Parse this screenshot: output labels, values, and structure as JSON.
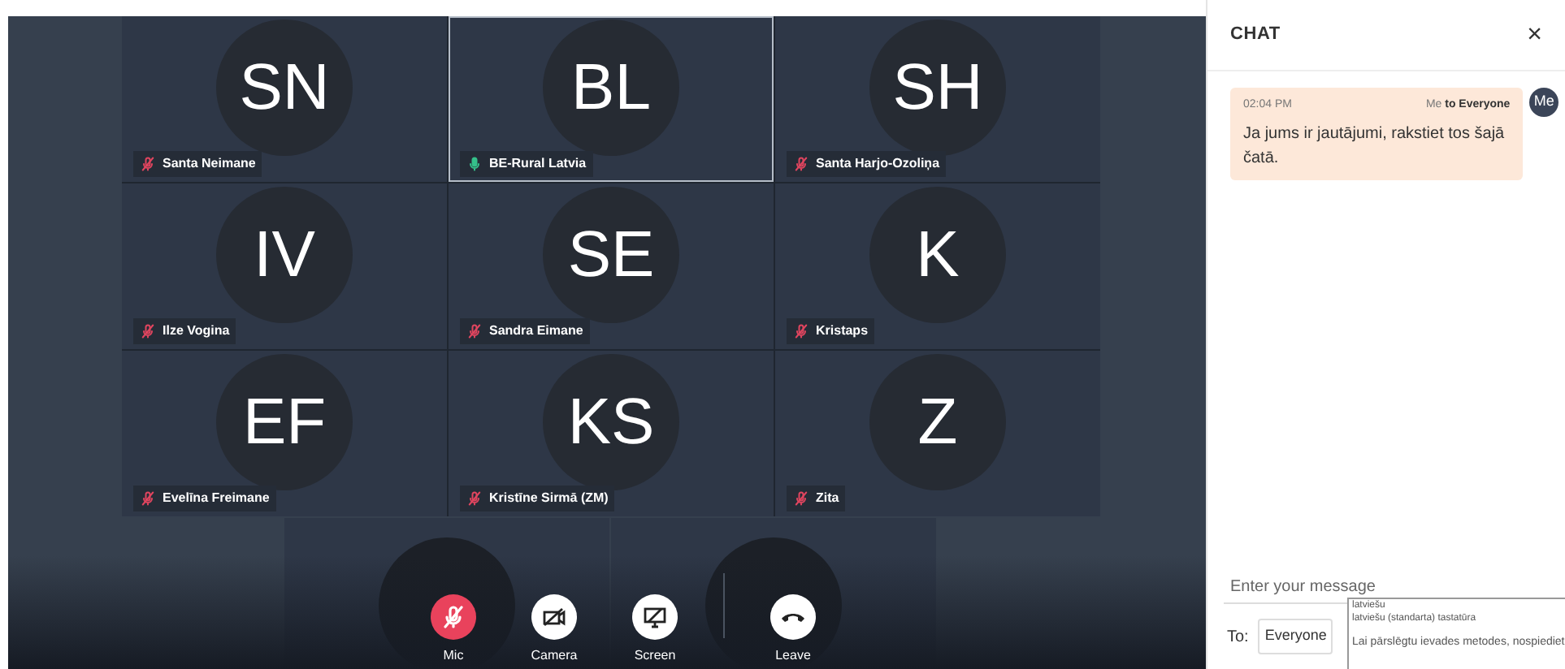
{
  "participants": [
    {
      "initials": "SN",
      "name": "Santa Neimane",
      "muted": true,
      "selected": false
    },
    {
      "initials": "BL",
      "name": "BE-Rural Latvia",
      "muted": false,
      "selected": true
    },
    {
      "initials": "SH",
      "name": "Santa Harjo-Ozoliņa",
      "muted": true,
      "selected": false
    },
    {
      "initials": "IV",
      "name": "Ilze Vogina",
      "muted": true,
      "selected": false
    },
    {
      "initials": "SE",
      "name": "Sandra Eimane",
      "muted": true,
      "selected": false
    },
    {
      "initials": "K",
      "name": "Kristaps",
      "muted": true,
      "selected": false
    },
    {
      "initials": "EF",
      "name": "Evelīna Freimane",
      "muted": true,
      "selected": false
    },
    {
      "initials": "KS",
      "name": "Kristīne Sirmā (ZM)",
      "muted": true,
      "selected": false
    },
    {
      "initials": "Z",
      "name": "Zita",
      "muted": true,
      "selected": false
    }
  ],
  "controls": [
    {
      "kind": "mic",
      "label": "Mic",
      "on": false
    },
    {
      "kind": "camera",
      "label": "Camera",
      "on": false
    },
    {
      "kind": "screen",
      "label": "Screen",
      "on": false
    },
    {
      "kind": "leave",
      "label": "Leave"
    }
  ],
  "chat": {
    "title": "CHAT",
    "close": "×",
    "messages": [
      {
        "time": "02:04 PM",
        "sender": "Me",
        "recipient": "to Everyone",
        "text": "Ja jums ir jautājumi, rakstiet tos šajā čatā.",
        "avatar": "Me"
      }
    ],
    "input": {
      "placeholder": "Enter your message"
    },
    "to_label": "To:",
    "to_value": "Everyone"
  },
  "ime_popup": {
    "lines": [
      "latviešu",
      "latviešu (standarta) tastatūra"
    ],
    "hint": "Lai pārslēgtu ievades metodes, nospiediet"
  }
}
